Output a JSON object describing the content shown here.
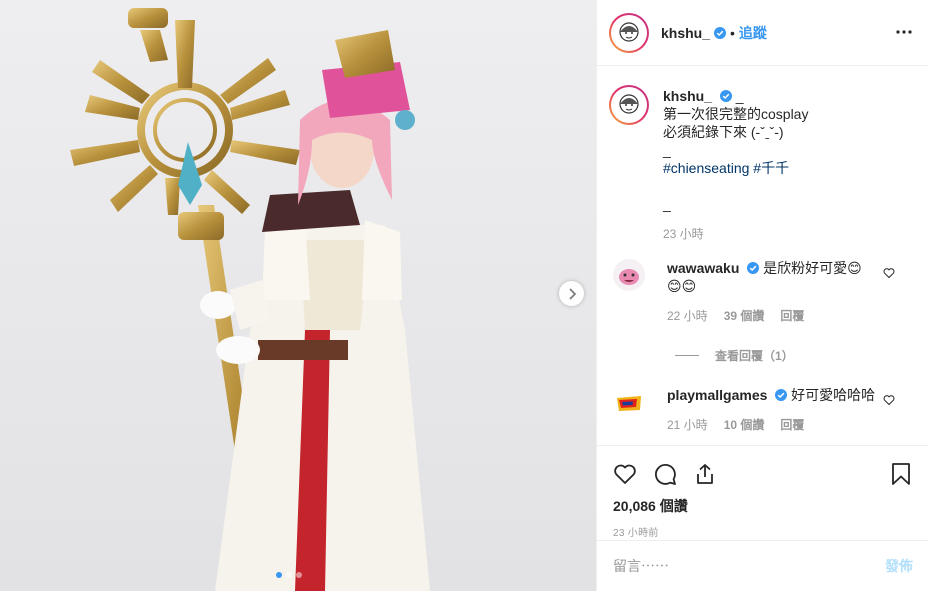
{
  "post": {
    "username": "khshu_",
    "follow_label": "追蹤",
    "dot": "•",
    "more_icon": "more-horizontal-icon",
    "image_dots": 3,
    "active_dot": 0
  },
  "caption": {
    "username": "khshu_",
    "suffix": "_",
    "lines": [
      "第一次很完整的cosplay",
      "必須紀錄下來 (-ˇˍˇ-)",
      "_"
    ],
    "hashtags": [
      "#chienseating",
      "#千千"
    ],
    "trailing": "_",
    "time": "23 小時"
  },
  "comments": [
    {
      "username": "wawawaku",
      "text": "是欣粉好可愛😊",
      "text2": "😊😊",
      "time": "22 小時",
      "likes": "39 個讚",
      "reply": "回覆",
      "view_replies": "查看回覆（1）"
    },
    {
      "username": "playmallgames",
      "text": "好可愛哈哈哈",
      "time": "21 小時",
      "likes": "10 個讚",
      "reply": "回覆"
    }
  ],
  "actions": {
    "like_count": "20,086 個讚",
    "time_ago": "23 小時前"
  },
  "add_comment": {
    "placeholder": "留言⋯⋯",
    "post_label": "發佈"
  },
  "colors": {
    "accent": "#3897f0",
    "hashtag": "#003569",
    "muted": "#999999",
    "post_disabled": "#b2dffc"
  }
}
